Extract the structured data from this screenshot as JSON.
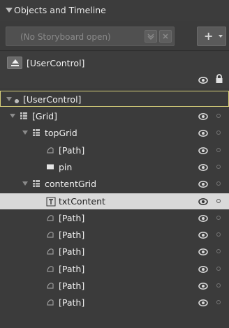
{
  "panel": {
    "title": "Objects and Timeline",
    "storyboard_placeholder": "(No Storyboard open)",
    "add_storyboard_label": "+"
  },
  "scope": {
    "label": "[UserControl]"
  },
  "tree": {
    "root": {
      "label": "[UserControl]"
    },
    "items": [
      {
        "label": "[Grid]",
        "type": "grid-icon"
      },
      {
        "label": "topGrid",
        "type": "grid-icon"
      },
      {
        "label": "[Path]",
        "type": "path-icon"
      },
      {
        "label": "pin",
        "type": "rectangle-icon"
      },
      {
        "label": "contentGrid",
        "type": "grid-icon"
      },
      {
        "label": "txtContent",
        "type": "textblock-icon",
        "selected": true
      },
      {
        "label": "[Path]",
        "type": "path-icon"
      },
      {
        "label": "[Path]",
        "type": "path-icon"
      },
      {
        "label": "[Path]",
        "type": "path-icon"
      },
      {
        "label": "[Path]",
        "type": "path-icon"
      },
      {
        "label": "[Path]",
        "type": "path-icon"
      },
      {
        "label": "[Path]",
        "type": "path-icon"
      }
    ]
  },
  "colors": {
    "background": "#3b3b3b",
    "selection": "#d9d9d9",
    "root_border": "#d7cf7a"
  }
}
